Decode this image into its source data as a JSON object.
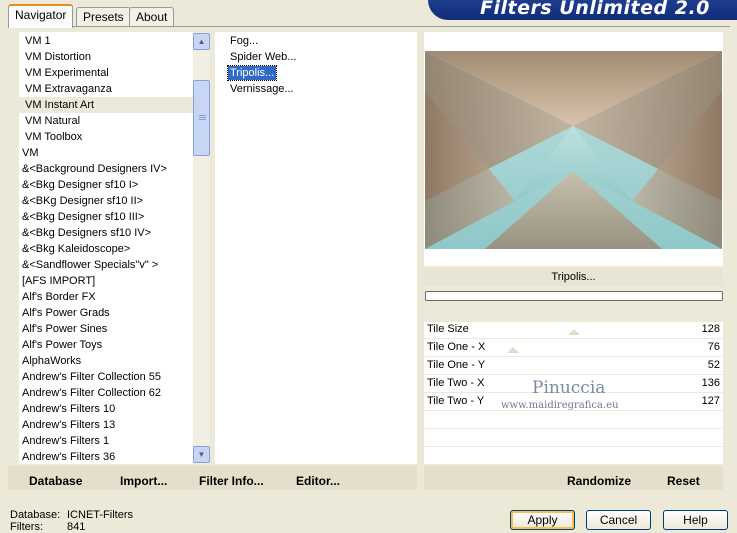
{
  "tabs": [
    {
      "label": "Navigator",
      "active": true
    },
    {
      "label": "Presets",
      "active": false
    },
    {
      "label": "About",
      "active": false
    }
  ],
  "banner_title": "Filters Unlimited 2.0",
  "categories": [
    "VM 1",
    "VM Distortion",
    "VM Experimental",
    "VM Extravaganza",
    "VM Instant Art",
    "VM Natural",
    "VM Toolbox",
    "VM",
    "&<Background Designers IV>",
    "&<Bkg Designer sf10 I>",
    "&<BKg Designer sf10 II>",
    "&<Bkg Designer sf10 III>",
    "&<Bkg Designers sf10 IV>",
    "&<Bkg Kaleidoscope>",
    "&<Sandflower Specials\"v\" >",
    "[AFS IMPORT]",
    "Alf's Border FX",
    "Alf's Power Grads",
    "Alf's Power Sines",
    "Alf's Power Toys",
    "AlphaWorks",
    "Andrew's Filter Collection 55",
    "Andrew's Filter Collection 62",
    "Andrew's Filters 10",
    "Andrew's Filters 13",
    "Andrew's Filters 1",
    "Andrew's Filters 36"
  ],
  "selected_category": "VM Instant Art",
  "filters": [
    "Fog...",
    "Spider Web...",
    "Tripolis...",
    "Vernissage..."
  ],
  "selected_filter": "Tripolis...",
  "filter_name": "Tripolis...",
  "params": [
    {
      "name": "Tile Size",
      "value": "128"
    },
    {
      "name": "Tile One - X",
      "value": "76"
    },
    {
      "name": "Tile One - Y",
      "value": "52"
    },
    {
      "name": "Tile Two - X",
      "value": "136"
    },
    {
      "name": "Tile Two - Y",
      "value": "127"
    }
  ],
  "watermark": {
    "line1": "Pinuccia",
    "line2": "www.maidiregrafica.eu"
  },
  "menu": {
    "database": "Database",
    "import": "Import...",
    "filter_info": "Filter Info...",
    "editor": "Editor..."
  },
  "actions": {
    "randomize": "Randomize",
    "reset": "Reset"
  },
  "buttons": {
    "apply": "Apply",
    "cancel": "Cancel",
    "help": "Help"
  },
  "status": {
    "database_label": "Database:",
    "database_value": "ICNET-Filters",
    "filters_label": "Filters:",
    "filters_value": "841"
  },
  "colors": {
    "banner": "#1f3d8f",
    "selection": "#316ac5",
    "preview_teal": "#a3d4d4",
    "preview_tan": "#a89078"
  },
  "icons": {
    "scroll_up": "up-arrow-icon",
    "scroll_down": "down-arrow-icon"
  }
}
